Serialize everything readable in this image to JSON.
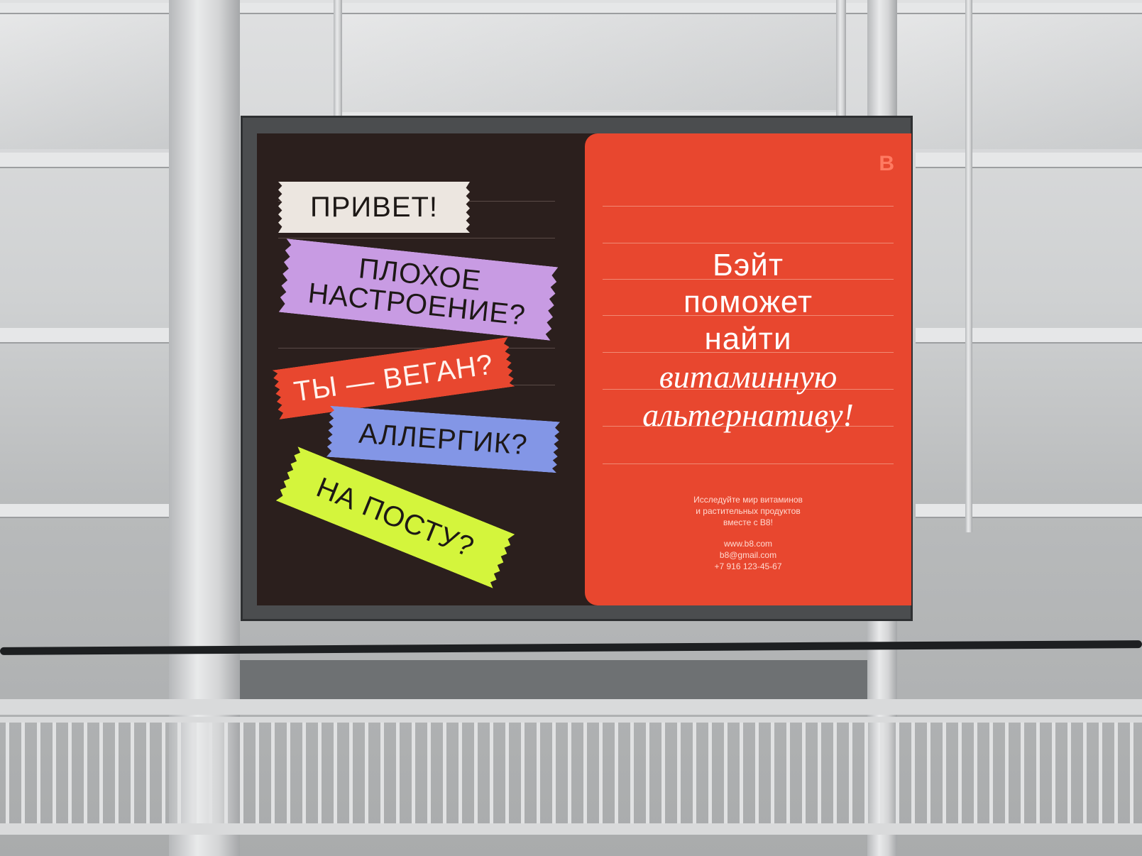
{
  "poster": {
    "tapes": [
      {
        "text": "ПРИВЕТ!",
        "color": "#ece6e0"
      },
      {
        "text": "ПЛОХОЕ НАСТРОЕНИЕ?",
        "color": "#c89be3"
      },
      {
        "text": "ТЫ — ВЕГАН?",
        "color": "#e8472f"
      },
      {
        "text": "АЛЛЕРГИК?",
        "color": "#8396e6"
      },
      {
        "text": "НА ПОСТУ?",
        "color": "#d4f53c"
      }
    ],
    "logo": "B",
    "headline": {
      "line1": "Бэйт",
      "line2": "поможет",
      "line3": "найти",
      "line4": "витаминную",
      "line5": "альтернативу!"
    },
    "blurb": {
      "line1": "Исследуйте мир витаминов",
      "line2": "и растительных продуктов",
      "line3": "вместе с В8!"
    },
    "contacts": {
      "website": "www.b8.com",
      "email": "b8@gmail.com",
      "phone": "+7 916 123-45-67"
    },
    "colors": {
      "background": "#2b1f1d",
      "panel": "#e8472f"
    }
  }
}
